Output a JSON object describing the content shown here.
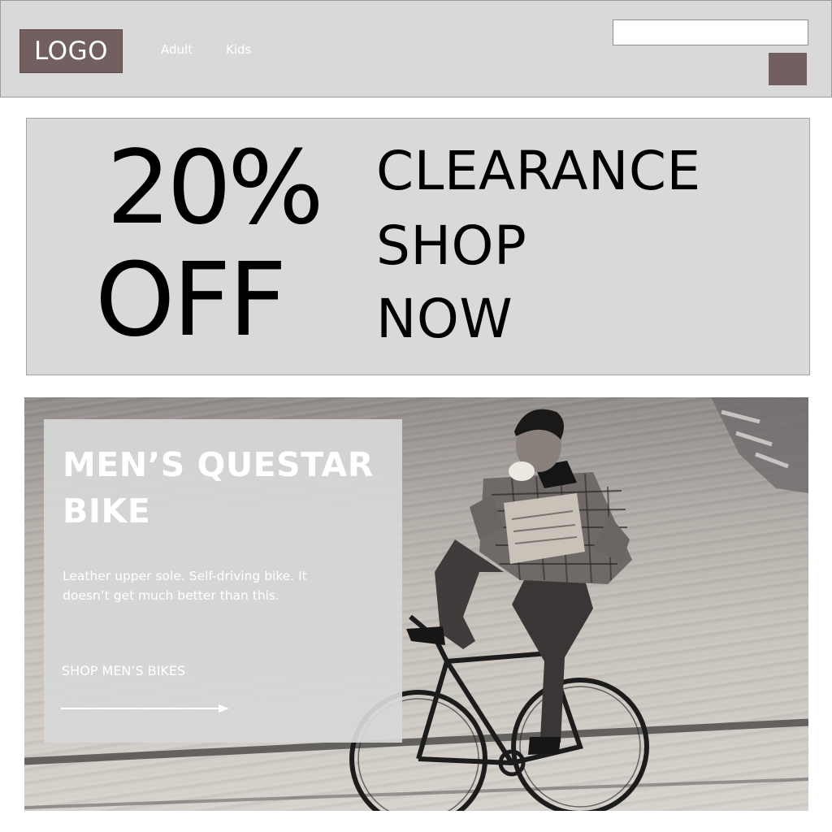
{
  "header": {
    "logo": "LOGO",
    "nav": [
      {
        "label": "Adult"
      },
      {
        "label": "Kids"
      }
    ],
    "search": {
      "value": "",
      "placeholder": ""
    }
  },
  "promo": {
    "discount": "20%",
    "discount_suffix": "OFF",
    "lines": [
      "CLEARANCE",
      "SHOP",
      "NOW"
    ]
  },
  "hero": {
    "title": "MEN’S QUESTAR BIKE",
    "description": "Leather upper sole. Self-driving bike. It doesn’t get much better than this.",
    "cta_label": "SHOP MEN’S BIKES"
  },
  "colors": {
    "brand": "#725f60",
    "header_bg": "#d9d9d9",
    "banner_bg": "#d9d9d9"
  },
  "icons": {
    "search_button": "search-icon"
  }
}
